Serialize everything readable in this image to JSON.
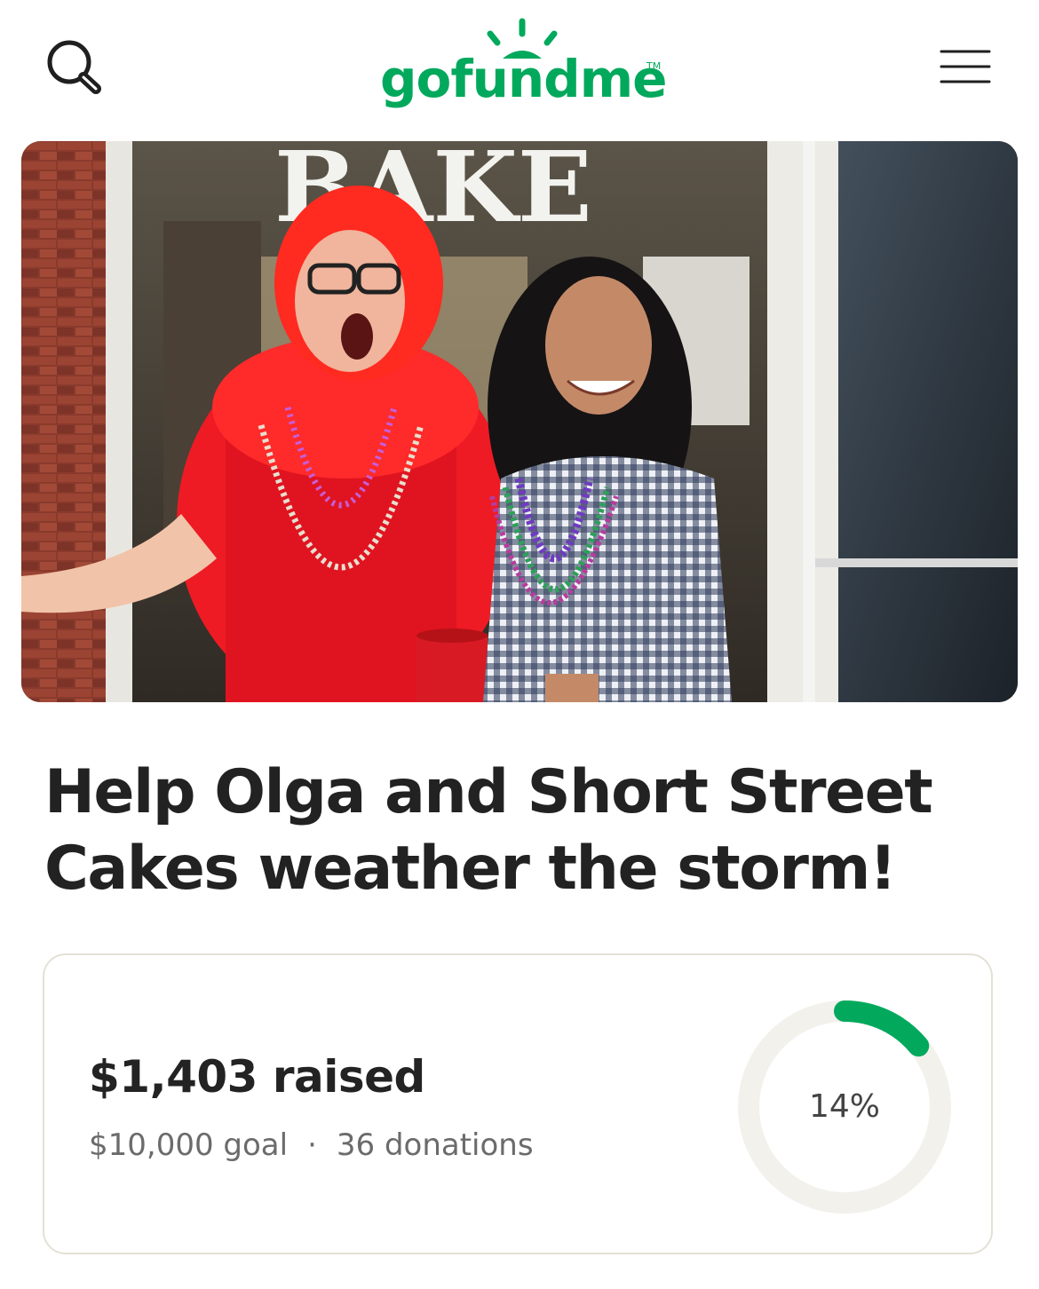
{
  "header": {
    "logo_text": "gofundme",
    "logo_tm": "TM",
    "search_icon": "search-icon",
    "menu_icon": "hamburger-menu-icon",
    "brand_color": "#02a95c"
  },
  "hero": {
    "icon": "campaign-photo",
    "sign_text": "BAKE"
  },
  "campaign": {
    "title": "Help Olga and Short Street Cakes weather the storm!"
  },
  "progress": {
    "raised": "$1,403 raised",
    "goal": "$10,000 goal",
    "separator": "·",
    "donations": "36 donations",
    "percent_label": "14%",
    "percent": 14,
    "track_color": "#f2f1ec",
    "fill_color": "#02a95c"
  }
}
